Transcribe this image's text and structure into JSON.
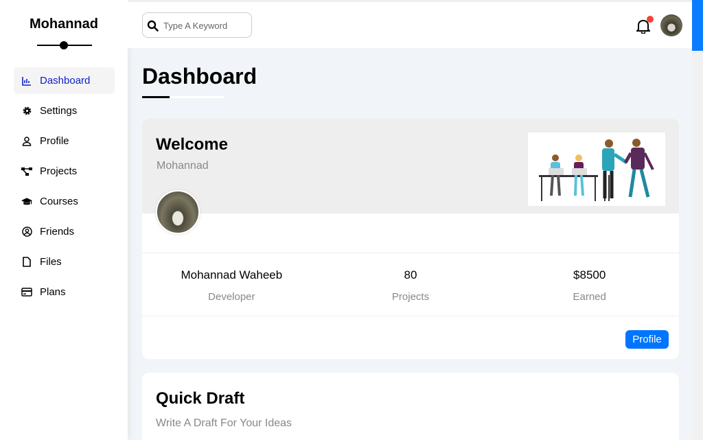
{
  "sidebar": {
    "brand": "Mohannad",
    "items": [
      {
        "label": "Dashboard",
        "icon": "chart-icon",
        "active": true
      },
      {
        "label": "Settings",
        "icon": "gear-icon"
      },
      {
        "label": "Profile",
        "icon": "user-icon"
      },
      {
        "label": "Projects",
        "icon": "diagram-icon"
      },
      {
        "label": "Courses",
        "icon": "graduation-cap-icon"
      },
      {
        "label": "Friends",
        "icon": "user-circle-icon"
      },
      {
        "label": "Files",
        "icon": "file-icon"
      },
      {
        "label": "Plans",
        "icon": "credit-card-icon"
      }
    ]
  },
  "header": {
    "search_placeholder": "Type A Keyword",
    "notification_dot_color": "#f44336"
  },
  "main": {
    "title": "Dashboard",
    "welcome": {
      "heading": "Welcome",
      "name": "Mohannad",
      "stats": [
        {
          "value": "Mohannad Waheeb",
          "label": "Developer"
        },
        {
          "value": "80",
          "label": "Projects"
        },
        {
          "value": "$8500",
          "label": "Earned"
        }
      ],
      "profile_button": "Profile"
    },
    "draft": {
      "title": "Quick Draft",
      "subtitle": "Write A Draft For Your Ideas"
    }
  },
  "colors": {
    "accent": "#0075ff",
    "active_nav_text": "#0d20c8",
    "page_bg": "#f1f5f9"
  }
}
